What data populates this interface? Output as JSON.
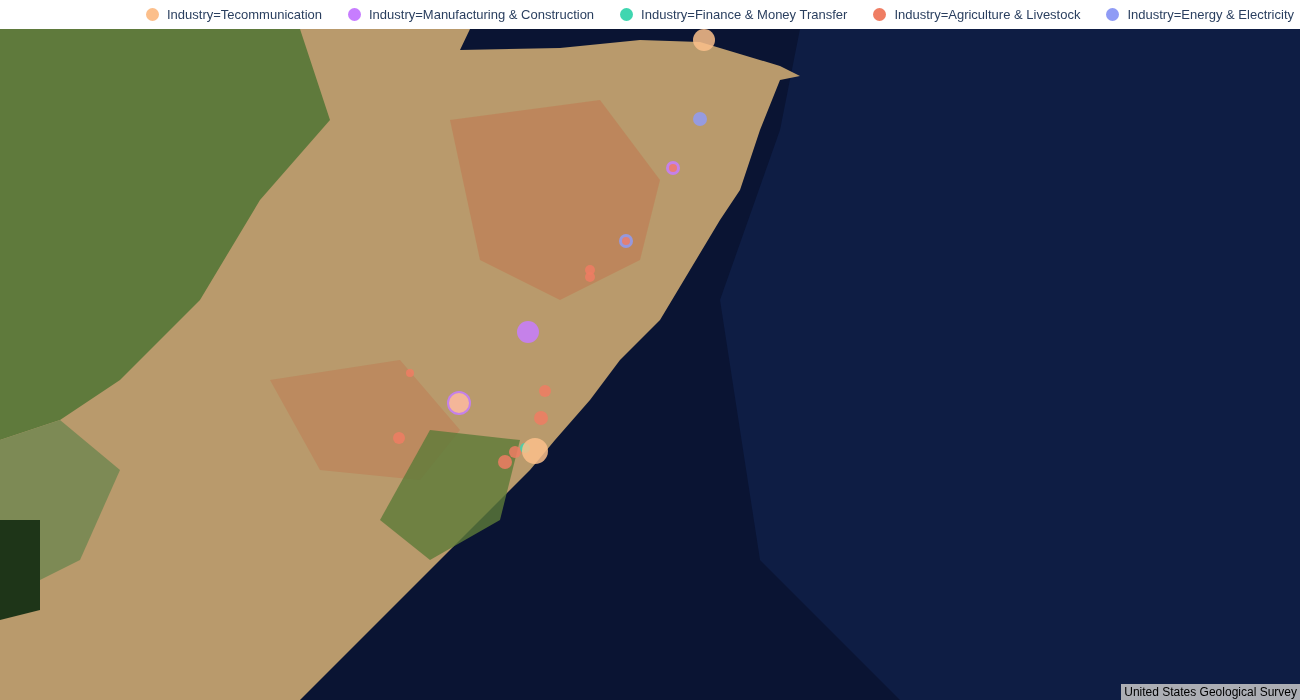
{
  "legend": [
    {
      "label": "Industry=Tecommunication",
      "color": "#fcbf8b"
    },
    {
      "label": "Industry=Manufacturing & Construction",
      "color": "#c77dff"
    },
    {
      "label": "Industry=Finance & Money Transfer",
      "color": "#3fd6b0"
    },
    {
      "label": "Industry=Agriculture & Livestock",
      "color": "#ef7d63"
    },
    {
      "label": "Industry=Energy & Electricity",
      "color": "#8f9bf5"
    }
  ],
  "map": {
    "attribution": "United States Geological Survey"
  }
}
